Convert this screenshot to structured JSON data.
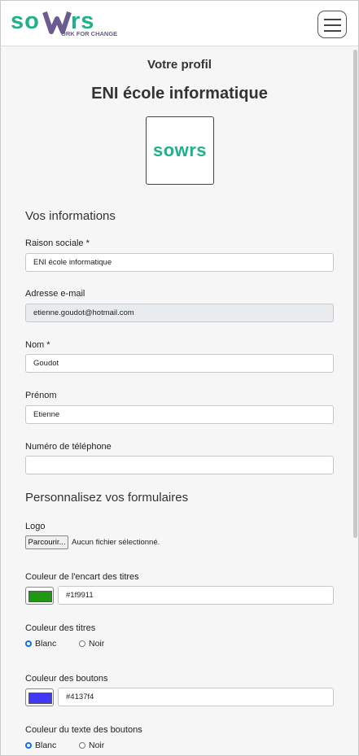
{
  "brand": {
    "name": "sowrs",
    "tagline": "ORK FOR CHANGE",
    "color_teal": "#20b08a",
    "color_purple": "#6b5b8f"
  },
  "page": {
    "profile_heading": "Votre profil",
    "school_name": "ENI école informatique"
  },
  "info": {
    "section_title": "Vos informations",
    "raison_sociale_label": "Raison sociale *",
    "raison_sociale_value": "ENI école informatique",
    "email_label": "Adresse e-mail",
    "email_value": "etienne.goudot@hotmail.com",
    "nom_label": "Nom *",
    "nom_value": "Goudot",
    "prenom_label": "Prénom",
    "prenom_value": "Etienne",
    "phone_label": "Numéro de téléphone",
    "phone_value": ""
  },
  "forms": {
    "section_title": "Personnalisez vos formulaires",
    "logo_label": "Logo",
    "file_button": "Parcourir...",
    "file_status": "Aucun fichier sélectionné.",
    "title_box_color_label": "Couleur de l'encart des titres",
    "title_box_color_value": "#1f9911",
    "title_color_label": "Couleur des titres",
    "title_color_options": [
      "Blanc",
      "Noir"
    ],
    "title_color_selected": "Blanc",
    "button_color_label": "Couleur des boutons",
    "button_color_value": "#4137f4",
    "button_text_color_label": "Couleur du texte des boutons",
    "button_text_color_options": [
      "Blanc",
      "Noir"
    ],
    "button_text_color_selected": "Blanc"
  }
}
